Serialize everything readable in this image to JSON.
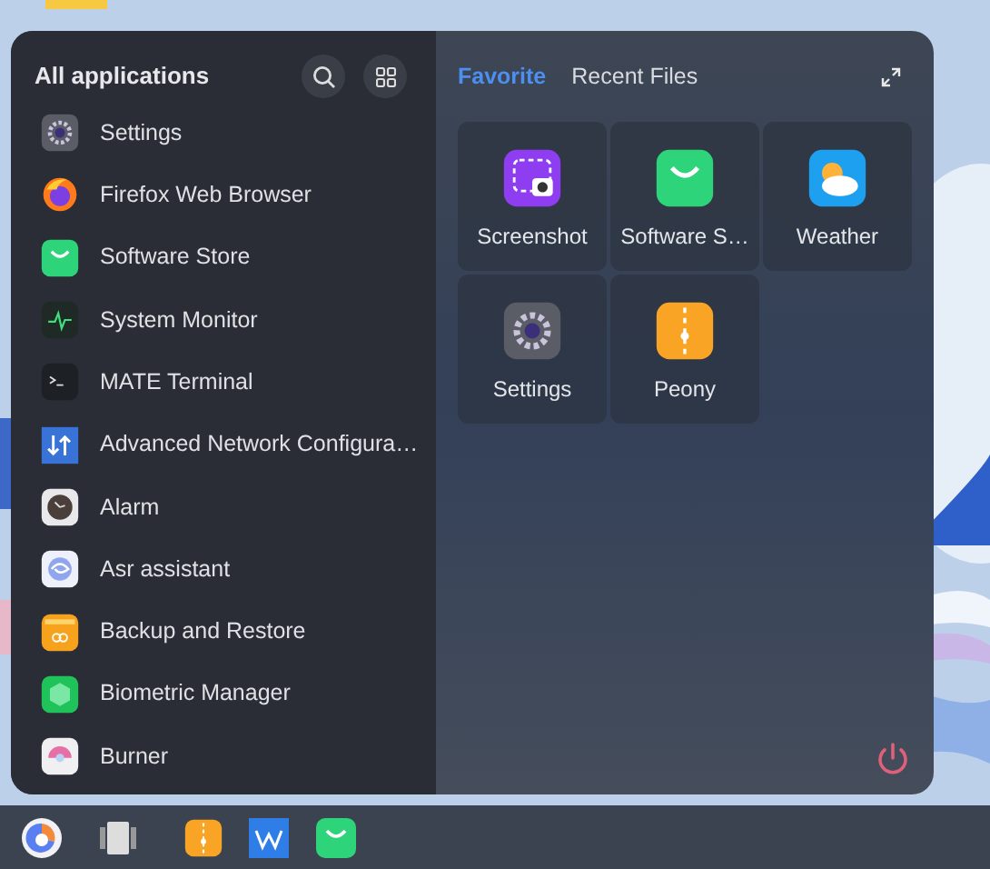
{
  "all_apps": {
    "title": "All applications",
    "items": [
      {
        "label": "Settings"
      },
      {
        "label": "Firefox Web Browser"
      },
      {
        "label": "Software Store"
      },
      {
        "label": "System Monitor"
      },
      {
        "label": "MATE Terminal"
      },
      {
        "label": "Advanced Network Configura…"
      },
      {
        "label": "Alarm"
      },
      {
        "label": "Asr assistant"
      },
      {
        "label": "Backup and Restore"
      },
      {
        "label": "Biometric Manager"
      },
      {
        "label": "Burner"
      }
    ]
  },
  "tabs": [
    {
      "label": "Favorite",
      "selected": true
    },
    {
      "label": "Recent Files",
      "selected": false
    }
  ],
  "favorites": [
    {
      "label": "Screenshot"
    },
    {
      "label": "Software S…"
    },
    {
      "label": "Weather"
    },
    {
      "label": "Settings"
    },
    {
      "label": "Peony"
    }
  ]
}
